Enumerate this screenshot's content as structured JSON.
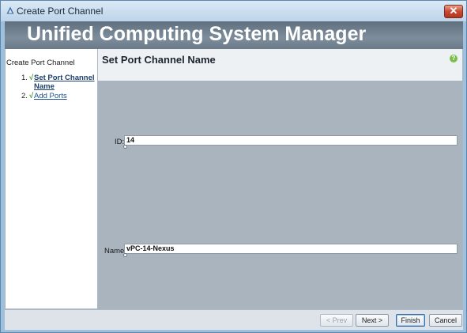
{
  "window": {
    "title": "Create Port Channel",
    "close_glyph": "✕",
    "icon": "ucs-triangle-icon"
  },
  "banner": {
    "title": "Unified Computing System Manager"
  },
  "sidebar": {
    "header": "Create Port Channel",
    "steps": [
      {
        "number": "1.",
        "check": "√",
        "label_line1": "Set Port Channel",
        "label_line2": "Name",
        "active": true
      },
      {
        "number": "2.",
        "check": "√",
        "label_line1": "Add Ports",
        "label_line2": "",
        "active": false
      }
    ]
  },
  "main": {
    "title": "Set Port Channel Name",
    "help_glyph": "?",
    "fields": {
      "id": {
        "label": "ID:",
        "value": "14"
      },
      "name": {
        "label": "Name:",
        "value": "vPC-14-Nexus"
      }
    }
  },
  "footer": {
    "prev_label": "< Prev",
    "next_label": "Next >",
    "finish_label": "Finish",
    "cancel_label": "Cancel"
  },
  "colors": {
    "banner": "#6b7a88",
    "content_bg": "#a9b4be",
    "link": "#1f4f8a",
    "check": "#3c9a2e",
    "close_button": "#c74a33"
  }
}
